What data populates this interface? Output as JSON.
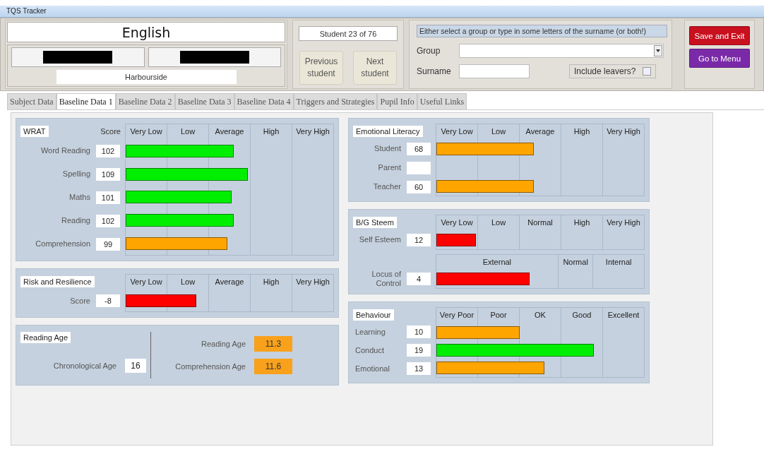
{
  "window": {
    "title": "TQS Tracker"
  },
  "header": {
    "subject": "English",
    "name_fields": [
      {
        "redacted": true
      },
      {
        "redacted": true
      }
    ],
    "school": "Harbourside",
    "student_counter": "Student 23 of 76",
    "nav_buttons": [
      "Previous student",
      "Next student"
    ],
    "search": {
      "instruction": "Either select a group or type in some letters of the surname (or both!)",
      "group_label": "Group",
      "surname_label": "Surname",
      "include_leavers": {
        "label": "Include leavers?",
        "checked": false
      }
    },
    "action_buttons": [
      {
        "label": "Save and Exit",
        "color": "#c8101f"
      },
      {
        "label": "Go to Menu",
        "color": "#7a2aa8"
      }
    ]
  },
  "tabs": [
    {
      "label": "Subject Data",
      "selected": false
    },
    {
      "label": "Baseline Data 1",
      "selected": true
    },
    {
      "label": "Baseline Data 2",
      "selected": false
    },
    {
      "label": "Baseline Data 3",
      "selected": false
    },
    {
      "label": "Baseline Data 4",
      "selected": false
    },
    {
      "label": "Triggers and Strategies",
      "selected": false
    },
    {
      "label": "Pupil Info",
      "selected": false
    },
    {
      "label": "Useful Links",
      "selected": false
    }
  ],
  "columns": [
    {
      "panels": [
        {
          "kind": "bands",
          "title": "WRAT",
          "score_heading": "Score",
          "sections": [
            {
              "bands": [
                {
                  "label": "Very Low"
                },
                {
                  "label": "Low"
                },
                {
                  "label": "Average"
                },
                {
                  "label": "High"
                },
                {
                  "label": "Very High"
                }
              ],
              "rows": [
                {
                  "label": "Word Reading",
                  "value": "102",
                  "level": 0.52,
                  "color": "#00ee00"
                },
                {
                  "label": "Spelling",
                  "value": "109",
                  "level": 0.59,
                  "color": "#00ee00"
                },
                {
                  "label": "Maths",
                  "value": "101",
                  "level": 0.51,
                  "color": "#00ee00"
                },
                {
                  "label": "Reading",
                  "value": "102",
                  "level": 0.52,
                  "color": "#00ee00"
                },
                {
                  "label": "Comprehension",
                  "value": "99",
                  "level": 0.49,
                  "color": "#ffa500"
                }
              ]
            }
          ]
        },
        {
          "kind": "bands",
          "title": "Risk and Resilience",
          "sections": [
            {
              "bands": [
                {
                  "label": "Very Low"
                },
                {
                  "label": "Low"
                },
                {
                  "label": "Average"
                },
                {
                  "label": "High"
                },
                {
                  "label": "Very High"
                }
              ],
              "rows": [
                {
                  "label": "Score",
                  "value": "-8",
                  "level": 0.34,
                  "color": "#ff0000"
                }
              ]
            }
          ]
        },
        {
          "kind": "ages",
          "title": "Reading Age",
          "chronological": {
            "label": "Chronological Age",
            "value": "16"
          },
          "results": [
            {
              "label": "Reading Age",
              "value": "11.3",
              "color": "#f9a11b"
            },
            {
              "label": "Comprehension Age",
              "value": "11.6",
              "color": "#f9a11b"
            }
          ]
        }
      ]
    },
    {
      "panels": [
        {
          "kind": "bands",
          "title": "Emotional Literacy",
          "sections": [
            {
              "bands": [
                {
                  "label": "Very Low"
                },
                {
                  "label": "Low"
                },
                {
                  "label": "Average"
                },
                {
                  "label": "High"
                },
                {
                  "label": "Very High"
                }
              ],
              "rows": [
                {
                  "label": "Student",
                  "value": "68",
                  "level": 0.47,
                  "color": "#ffa500"
                },
                {
                  "label": "Parent"
                },
                {
                  "label": "Teacher",
                  "value": "60",
                  "level": 0.47,
                  "color": "#ffa500"
                }
              ]
            }
          ]
        },
        {
          "kind": "bands",
          "title": "B/G Steem",
          "sections": [
            {
              "bands": [
                {
                  "label": "Very Low"
                },
                {
                  "label": "Low"
                },
                {
                  "label": "Normal"
                },
                {
                  "label": "High"
                },
                {
                  "label": "Very High"
                }
              ],
              "rows": [
                {
                  "label": "Self Esteem",
                  "value": "12",
                  "level": 0.19,
                  "color": "#ff0000"
                }
              ]
            },
            {
              "bands": [
                {
                  "label": "External"
                },
                {
                  "label": "Normal"
                },
                {
                  "label": "Internal"
                }
              ],
              "rows": [
                {
                  "label": "Locus of Control",
                  "value": "4",
                  "level": 0.45,
                  "color": "#ff0000"
                }
              ]
            }
          ]
        },
        {
          "kind": "bands",
          "title": "Behaviour",
          "sections": [
            {
              "bands": [
                {
                  "label": "Very Poor"
                },
                {
                  "label": "Poor"
                },
                {
                  "label": "OK"
                },
                {
                  "label": "Good"
                },
                {
                  "label": "Excellent"
                }
              ],
              "rows": [
                {
                  "label": "Learning",
                  "value": "10",
                  "level": 0.4,
                  "color": "#ffa500"
                },
                {
                  "label": "Conduct",
                  "value": "19",
                  "level": 0.76,
                  "color": "#00ee00"
                },
                {
                  "label": "Emotional",
                  "value": "13",
                  "level": 0.52,
                  "color": "#ffa500"
                }
              ]
            }
          ]
        }
      ]
    }
  ]
}
